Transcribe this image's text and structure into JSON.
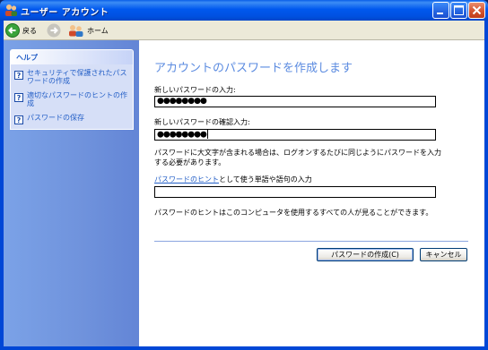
{
  "window": {
    "title": "ユーザー アカウント"
  },
  "toolbar": {
    "back_label": "戻る",
    "home_label": "ホーム"
  },
  "help": {
    "header": "ヘルプ",
    "items": [
      {
        "label": "セキュリティで保護されたパスワードの作成"
      },
      {
        "label": "適切なパスワードのヒントの作成"
      },
      {
        "label": "パスワードの保存"
      }
    ]
  },
  "main": {
    "heading": "アカウントのパスワードを作成します",
    "new_password_label": "新しいパスワードの入力:",
    "new_password_value": "●●●●●●●●",
    "confirm_password_label": "新しいパスワードの確認入力:",
    "confirm_password_value": "●●●●●●●●",
    "case_note": "パスワードに大文字が含まれる場合は、ログオンするたびに同じようにパスワードを入力する必要があります。",
    "hint_label_link": "パスワードのヒント",
    "hint_label_rest": "として使う単語や語句の入力",
    "hint_value": "",
    "hint_note": "パスワードのヒントはこのコンピュータを使用するすべての人が見ることができます。",
    "create_button": "パスワードの作成(C)",
    "cancel_button": "キャンセル"
  }
}
